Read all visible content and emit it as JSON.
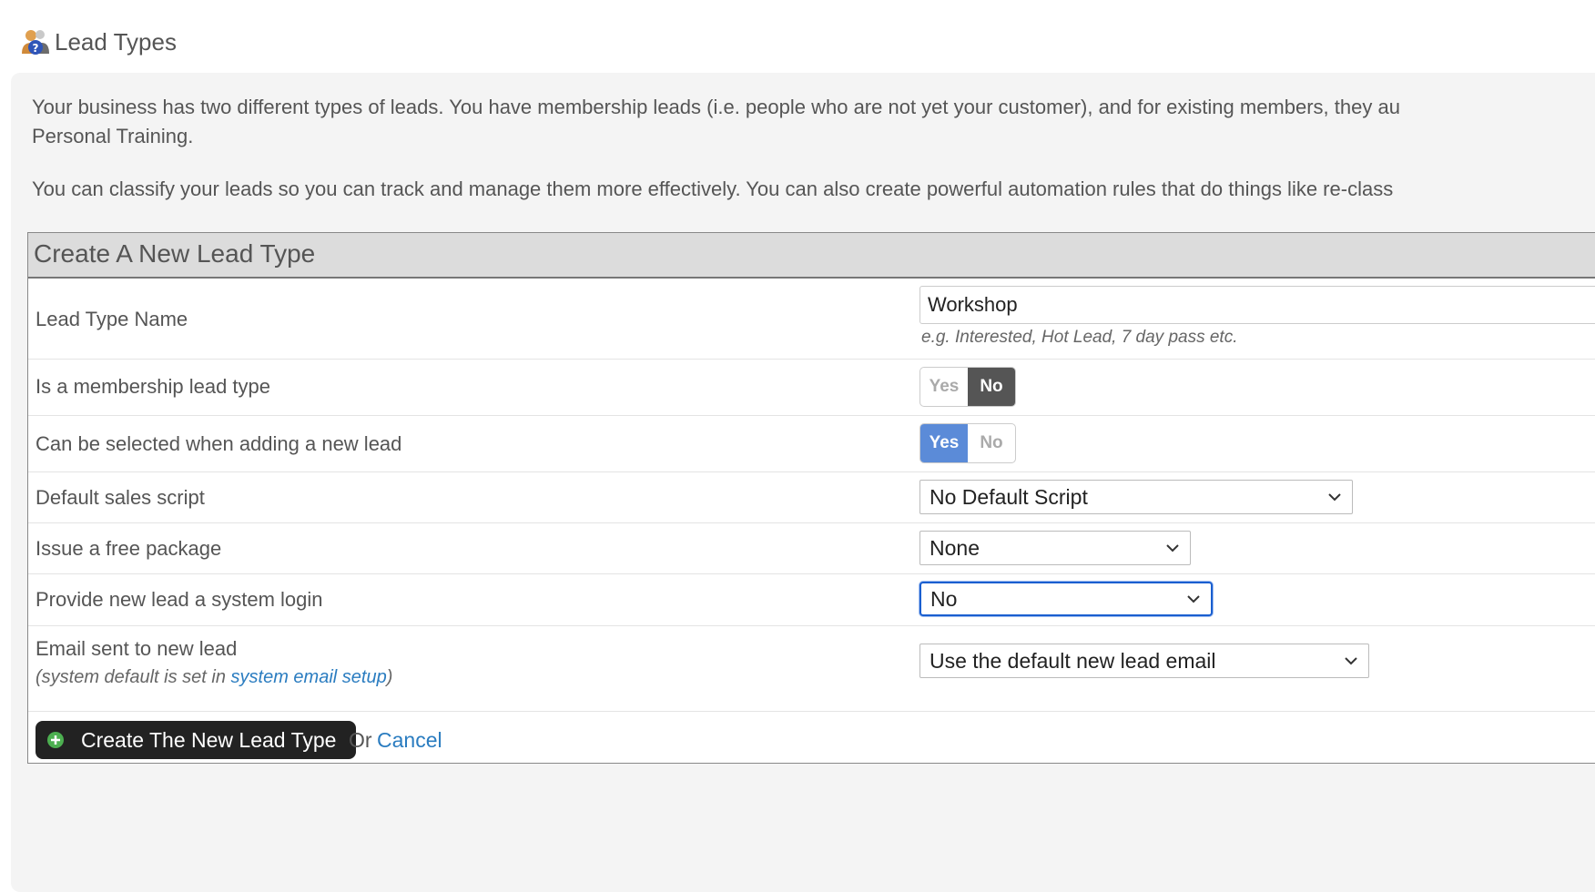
{
  "header": {
    "title": "Lead Types",
    "icon": "users-help-icon"
  },
  "intro": {
    "paragraph1_line1": "Your business has two different types of leads. You have membership leads (i.e. people who are not yet your customer), and for existing members, they au",
    "paragraph1_line2": "Personal Training.",
    "paragraph2": "You can classify your leads so you can track and manage them more effectively. You can also create powerful automation rules that do things like re-class"
  },
  "form": {
    "title": "Create A New Lead Type",
    "name_label": "Lead Type Name",
    "name_value": "Workshop",
    "name_hint": "e.g. Interested, Hot Lead, 7 day pass etc.",
    "membership_label": "Is a membership lead type",
    "membership_toggle": {
      "yes": "Yes",
      "no": "No",
      "selected": "No"
    },
    "selectable_label": "Can be selected when adding a new lead",
    "selectable_toggle": {
      "yes": "Yes",
      "no": "No",
      "selected": "Yes"
    },
    "script_label": "Default sales script",
    "script_value": "No Default Script",
    "package_label": "Issue a free package",
    "package_value": "None",
    "login_label": "Provide new lead a system login",
    "login_value": "No",
    "email_label": "Email sent to new lead",
    "email_note_prefix": "(system default is set in ",
    "email_note_link": "system email setup",
    "email_note_suffix": ")",
    "email_value": "Use the default new lead email",
    "create_button": "Create The New Lead Type",
    "or_text": "Or",
    "cancel_link": "Cancel"
  },
  "colors": {
    "accent_blue": "#5b8bd8",
    "dark_toggle": "#555555",
    "link": "#2a7cc0",
    "focus": "#1a5fd0",
    "button_plus": "#4caf50"
  }
}
